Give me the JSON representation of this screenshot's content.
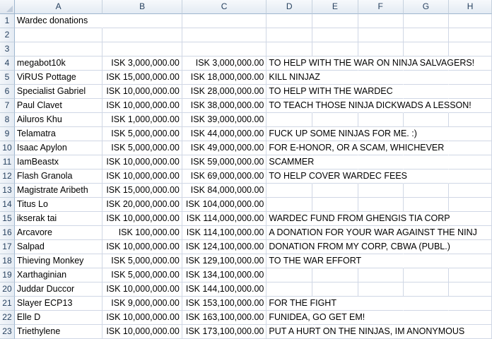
{
  "columns": [
    "A",
    "B",
    "C",
    "D",
    "E",
    "F",
    "G",
    "H"
  ],
  "rows": [
    {
      "n": "1",
      "name": "Wardec donations",
      "amount": "",
      "total": "",
      "note": ""
    },
    {
      "n": "2",
      "name": "",
      "amount": "",
      "total": "",
      "note": ""
    },
    {
      "n": "3",
      "name": "",
      "amount": "",
      "total": "",
      "note": ""
    },
    {
      "n": "4",
      "name": "megabot10k",
      "amount": "ISK 3,000,000.00",
      "total": "ISK 3,000,000.00",
      "note": "TO HELP WITH THE WAR ON NINJA SALVAGERS!"
    },
    {
      "n": "5",
      "name": "ViRUS Pottage",
      "amount": "ISK 15,000,000.00",
      "total": "ISK 18,000,000.00",
      "note": "KILL NINJAZ"
    },
    {
      "n": "6",
      "name": "Specialist Gabriel",
      "amount": "ISK 10,000,000.00",
      "total": "ISK 28,000,000.00",
      "note": "TO HELP WITH THE WARDEC"
    },
    {
      "n": "7",
      "name": "Paul Clavet",
      "amount": "ISK 10,000,000.00",
      "total": "ISK 38,000,000.00",
      "note": "TO TEACH THOSE NINJA DICKWADS A LESSON!"
    },
    {
      "n": "8",
      "name": "Ailuros Khu",
      "amount": "ISK 1,000,000.00",
      "total": "ISK 39,000,000.00",
      "note": ""
    },
    {
      "n": "9",
      "name": "Telamatra",
      "amount": "ISK 5,000,000.00",
      "total": "ISK 44,000,000.00",
      "note": "FUCK UP SOME NINJAS FOR ME. :)"
    },
    {
      "n": "10",
      "name": "Isaac Apylon",
      "amount": "ISK 5,000,000.00",
      "total": "ISK 49,000,000.00",
      "note": "FOR E-HONOR, OR A SCAM, WHICHEVER"
    },
    {
      "n": "11",
      "name": "IamBeastx",
      "amount": "ISK 10,000,000.00",
      "total": "ISK 59,000,000.00",
      "note": "SCAMMER"
    },
    {
      "n": "12",
      "name": "Flash Granola",
      "amount": "ISK 10,000,000.00",
      "total": "ISK 69,000,000.00",
      "note": "TO HELP COVER WARDEC FEES"
    },
    {
      "n": "13",
      "name": "Magistrate Aribeth",
      "amount": "ISK 15,000,000.00",
      "total": "ISK 84,000,000.00",
      "note": ""
    },
    {
      "n": "14",
      "name": "Titus Lo",
      "amount": "ISK 20,000,000.00",
      "total": "ISK 104,000,000.00",
      "note": ""
    },
    {
      "n": "15",
      "name": "ikserak tai",
      "amount": "ISK 10,000,000.00",
      "total": "ISK 114,000,000.00",
      "note": "WARDEC FUND FROM GHENGIS TIA CORP"
    },
    {
      "n": "16",
      "name": "Arcavore",
      "amount": "ISK 100,000.00",
      "total": "ISK 114,100,000.00",
      "note": "A DONATION FOR YOUR WAR AGAINST THE NINJ"
    },
    {
      "n": "17",
      "name": "Salpad",
      "amount": "ISK 10,000,000.00",
      "total": "ISK 124,100,000.00",
      "note": "DONATION FROM MY CORP, CBWA (PUBL.)"
    },
    {
      "n": "18",
      "name": "Thieving Monkey",
      "amount": "ISK 5,000,000.00",
      "total": "ISK 129,100,000.00",
      "note": "TO THE WAR EFFORT"
    },
    {
      "n": "19",
      "name": "Xarthaginian",
      "amount": "ISK 5,000,000.00",
      "total": "ISK 134,100,000.00",
      "note": ""
    },
    {
      "n": "20",
      "name": "Juddar Duccor",
      "amount": "ISK 10,000,000.00",
      "total": "ISK 144,100,000.00",
      "note": ""
    },
    {
      "n": "21",
      "name": "Slayer ECP13",
      "amount": "ISK 9,000,000.00",
      "total": "ISK 153,100,000.00",
      "note": "FOR THE FIGHT"
    },
    {
      "n": "22",
      "name": "Elle D",
      "amount": "ISK 10,000,000.00",
      "total": "ISK 163,100,000.00",
      "note": "FUNIDEA, GO GET EM!"
    },
    {
      "n": "23",
      "name": "Triethylene",
      "amount": "ISK 10,000,000.00",
      "total": "ISK 173,100,000.00",
      "note": "PUT A HURT ON THE NINJAS, IM ANONYMOUS"
    }
  ]
}
